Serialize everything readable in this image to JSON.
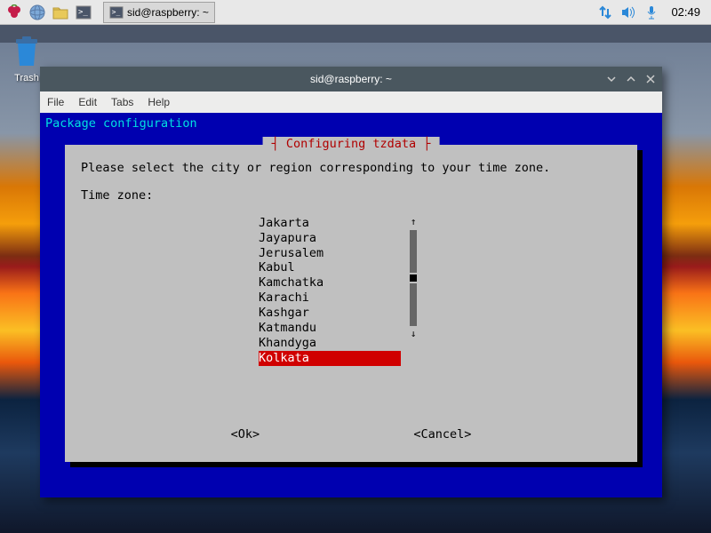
{
  "taskbar": {
    "app_title": "sid@raspberry: ~",
    "clock": "02:49"
  },
  "desktop": {
    "trash_label": "Trash"
  },
  "window": {
    "title": "sid@raspberry: ~",
    "menu": {
      "file": "File",
      "edit": "Edit",
      "tabs": "Tabs",
      "help": "Help"
    }
  },
  "terminal": {
    "header": "Package configuration",
    "dialog_title": "Configuring tzdata",
    "prompt": "Please select the city or region corresponding to your time zone.",
    "field_label": "Time zone:",
    "items": [
      {
        "label": "Jakarta",
        "selected": false
      },
      {
        "label": "Jayapura",
        "selected": false
      },
      {
        "label": "Jerusalem",
        "selected": false
      },
      {
        "label": "Kabul",
        "selected": false
      },
      {
        "label": "Kamchatka",
        "selected": false
      },
      {
        "label": "Karachi",
        "selected": false
      },
      {
        "label": "Kashgar",
        "selected": false
      },
      {
        "label": "Katmandu",
        "selected": false
      },
      {
        "label": "Khandyga",
        "selected": false
      },
      {
        "label": "Kolkata",
        "selected": true
      }
    ],
    "ok_label": "<Ok>",
    "cancel_label": "<Cancel>"
  }
}
